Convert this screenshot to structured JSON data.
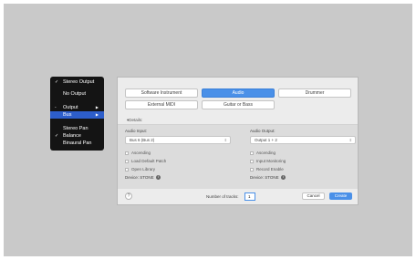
{
  "dialog": {
    "track_types": [
      {
        "label": "Software Instrument",
        "selected": false
      },
      {
        "label": "Audio",
        "selected": true
      },
      {
        "label": "Drummer",
        "selected": false
      },
      {
        "label": "External MIDI",
        "selected": false
      },
      {
        "label": "Guitar or Bass",
        "selected": false
      }
    ],
    "details_label": "Details:",
    "audio_input": {
      "title": "Audio Input:",
      "value": "Bus 6 (Bus 2)",
      "options": [
        "Ascending",
        "Load Default Patch",
        "Open Library"
      ],
      "device": "Device: STONE"
    },
    "audio_output": {
      "title": "Audio Output:",
      "value": "Output 1 + 2",
      "options": [
        "Ascending",
        "Input Monitoring",
        "Record Enable"
      ],
      "device": "Device: STONE"
    },
    "footer": {
      "help": "?",
      "tracks_label": "Number of tracks:",
      "tracks_value": "1",
      "cancel": "Cancel",
      "create": "Create"
    }
  },
  "context_menu": {
    "items": [
      {
        "label": "Stereo Output",
        "checked": true
      },
      {
        "label": "No Output",
        "checked": false
      },
      {
        "label": "Output",
        "submenu": true,
        "prefix": "-"
      },
      {
        "label": "Bus",
        "submenu": true,
        "highlighted": true
      },
      {
        "label": "Stereo Pan",
        "checked": false
      },
      {
        "label": "Balance",
        "checked": true
      },
      {
        "label": "Binaural Pan",
        "checked": false
      }
    ]
  },
  "colors": {
    "accent": "#4a90e8",
    "menu_bg": "#141414",
    "menu_highlight": "#2d5ecb"
  },
  "icons": {
    "checkmark": "checkmark-icon",
    "submenu": "submenu-arrow-icon",
    "info": "info-icon",
    "help": "help-icon",
    "chevron": "chevron-updown-icon"
  }
}
